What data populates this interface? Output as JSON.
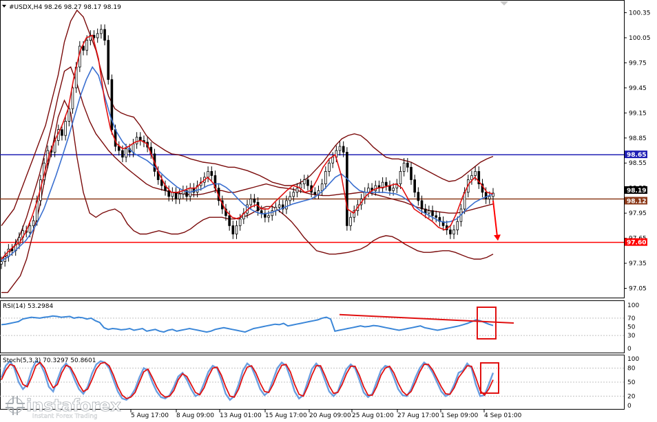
{
  "chart_data": {
    "type": "candlestick",
    "symbol_title": "#USDX,H4  98.26 98.27 98.17 98.19",
    "price_axis": {
      "ticks": [
        "100.35",
        "100.05",
        "99.75",
        "99.45",
        "99.15",
        "98.85",
        "98.55",
        "98.25",
        "97.95",
        "97.65",
        "97.35",
        "97.05"
      ],
      "range": [
        96.98,
        100.42
      ]
    },
    "levels": [
      {
        "label": "98.65",
        "value": 98.65,
        "color": "#1f1fb4"
      },
      {
        "label": "98.12",
        "value": 98.12,
        "color": "#8b3a1a"
      },
      {
        "label": "97.60",
        "value": 97.6,
        "color": "#ff0000"
      }
    ],
    "current_price": {
      "label": "98.19",
      "value": 98.19
    },
    "x_ticks": [
      "5 Aug 17:00",
      "8 Aug 09:00",
      "13 Aug 01:00",
      "15 Aug 17:00",
      "20 Aug 09:00",
      "25 Aug 01:00",
      "27 Aug 17:00",
      "1 Sep 09:00",
      "4 Sep 01:00"
    ],
    "candles": {
      "close": [
        97.37,
        97.43,
        97.52,
        97.5,
        97.58,
        97.66,
        97.74,
        97.72,
        97.8,
        97.86,
        98.1,
        98.35,
        98.55,
        98.7,
        98.68,
        98.82,
        98.95,
        98.88,
        99.05,
        99.2,
        99.45,
        99.7,
        99.95,
        99.9,
        100.02,
        100.08,
        100.05,
        100.1,
        100.15,
        100.02,
        99.55,
        98.95,
        98.75,
        98.7,
        98.62,
        98.72,
        98.68,
        98.78,
        98.86,
        98.82,
        98.8,
        98.74,
        98.66,
        98.45,
        98.35,
        98.28,
        98.22,
        98.15,
        98.2,
        98.12,
        98.18,
        98.22,
        98.15,
        98.25,
        98.2,
        98.28,
        98.32,
        98.38,
        98.45,
        98.4,
        98.25,
        98.1,
        98.0,
        97.92,
        97.8,
        97.7,
        97.8,
        97.88,
        97.95,
        98.05,
        98.12,
        98.08,
        97.98,
        97.95,
        97.9,
        97.92,
        97.98,
        98.02,
        98.05,
        98.0,
        98.1,
        98.15,
        98.2,
        98.25,
        98.3,
        98.35,
        98.28,
        98.2,
        98.18,
        98.22,
        98.3,
        98.45,
        98.55,
        98.62,
        98.7,
        98.75,
        98.68,
        97.8,
        97.9,
        97.98,
        98.05,
        98.12,
        98.2,
        98.25,
        98.22,
        98.28,
        98.25,
        98.32,
        98.28,
        98.22,
        98.25,
        98.3,
        98.45,
        98.55,
        98.5,
        98.35,
        98.2,
        98.1,
        98.0,
        97.95,
        97.98,
        97.92,
        97.9,
        97.85,
        97.8,
        97.75,
        97.7,
        97.75,
        97.85,
        98.0,
        98.2,
        98.35,
        98.4,
        98.45,
        98.3,
        98.2,
        98.12,
        98.15,
        98.19
      ],
      "spread": 0.12
    },
    "bollinger": {
      "upper": [
        97.8,
        97.9,
        98.0,
        98.2,
        98.4,
        98.6,
        98.8,
        99.0,
        99.3,
        99.6,
        100.0,
        100.25,
        100.38,
        100.3,
        100.1,
        99.9,
        99.6,
        99.35,
        99.2,
        99.15,
        99.12,
        99.1,
        99.0,
        98.88,
        98.8,
        98.75,
        98.7,
        98.66,
        98.65,
        98.63,
        98.6,
        98.58,
        98.56,
        98.55,
        98.54,
        98.52,
        98.5,
        98.5,
        98.48,
        98.46,
        98.43,
        98.4,
        98.36,
        98.32,
        98.3,
        98.28,
        98.28,
        98.3,
        98.34,
        98.4,
        98.48,
        98.56,
        98.66,
        98.76,
        98.84,
        98.88,
        98.9,
        98.88,
        98.82,
        98.74,
        98.68,
        98.62,
        98.6,
        98.6,
        98.58,
        98.56,
        98.52,
        98.48,
        98.44,
        98.4,
        98.36,
        98.33,
        98.34,
        98.38,
        98.44,
        98.5,
        98.56,
        98.6,
        98.63
      ],
      "middle": [
        97.4,
        97.45,
        97.55,
        97.7,
        97.9,
        98.15,
        98.4,
        98.7,
        99.0,
        99.35,
        99.65,
        99.7,
        99.5,
        99.25,
        99.05,
        98.9,
        98.8,
        98.7,
        98.62,
        98.55,
        98.48,
        98.42,
        98.36,
        98.3,
        98.26,
        98.24,
        98.22,
        98.2,
        98.19,
        98.18,
        98.17,
        98.17,
        98.18,
        98.2,
        98.22,
        98.22,
        98.2,
        98.2,
        98.22,
        98.24,
        98.26,
        98.28,
        98.3,
        98.28,
        98.26,
        98.25,
        98.24,
        98.22,
        98.2,
        98.18,
        98.17,
        98.16,
        98.16,
        98.17,
        98.18,
        98.18,
        98.19,
        98.2,
        98.2,
        98.18,
        98.16,
        98.14,
        98.12,
        98.1,
        98.08,
        98.05,
        98.02,
        98.0,
        97.98,
        97.97,
        97.96,
        97.95,
        97.95,
        97.96,
        97.98,
        98.0,
        98.02,
        98.04,
        98.06
      ],
      "lower": [
        97.0,
        97.0,
        97.1,
        97.2,
        97.4,
        97.7,
        98.0,
        98.4,
        98.7,
        99.1,
        99.3,
        99.15,
        98.62,
        98.2,
        97.95,
        97.9,
        97.95,
        97.98,
        98.0,
        97.95,
        97.82,
        97.74,
        97.7,
        97.7,
        97.72,
        97.74,
        97.72,
        97.7,
        97.7,
        97.72,
        97.76,
        97.82,
        97.87,
        97.9,
        97.9,
        97.9,
        97.88,
        97.88,
        97.9,
        97.92,
        97.96,
        98.0,
        98.03,
        98.03,
        97.98,
        97.92,
        97.85,
        97.76,
        97.66,
        97.58,
        97.5,
        97.48,
        97.46,
        97.46,
        97.47,
        97.48,
        97.5,
        97.52,
        97.56,
        97.62,
        97.66,
        97.68,
        97.67,
        97.63,
        97.58,
        97.54,
        97.5,
        97.48,
        97.48,
        97.49,
        97.5,
        97.5,
        97.48,
        97.45,
        97.42,
        97.4,
        97.4,
        97.42,
        97.46
      ]
    },
    "moving_averages": {
      "fast_red": [
        97.4,
        97.48,
        97.55,
        97.6,
        97.72,
        97.9,
        98.12,
        98.4,
        98.68,
        98.85,
        99.0,
        99.2,
        99.6,
        99.9,
        100.05,
        100.08,
        99.8,
        99.3,
        98.95,
        98.78,
        98.72,
        98.75,
        98.8,
        98.82,
        98.78,
        98.6,
        98.42,
        98.28,
        98.2,
        98.2,
        98.22,
        98.25,
        98.25,
        98.32,
        98.38,
        98.3,
        98.12,
        97.98,
        97.9,
        97.88,
        97.95,
        98.02,
        98.05,
        98.0,
        98.0,
        98.08,
        98.15,
        98.22,
        98.28,
        98.26,
        98.2,
        98.22,
        98.35,
        98.5,
        98.6,
        98.65,
        98.4,
        98.0,
        97.95,
        98.05,
        98.15,
        98.22,
        98.25,
        98.26,
        98.28,
        98.3,
        98.25,
        98.12,
        98.0,
        97.95,
        97.9,
        97.85,
        97.78,
        97.75,
        97.8,
        97.95,
        98.15,
        98.3,
        98.38,
        98.3,
        98.2,
        98.18
      ],
      "slow_blue": [
        97.38,
        97.42,
        97.48,
        97.55,
        97.62,
        97.72,
        97.85,
        98.0,
        98.2,
        98.4,
        98.62,
        98.85,
        99.1,
        99.35,
        99.55,
        99.7,
        99.6,
        99.35,
        99.1,
        98.92,
        98.8,
        98.72,
        98.66,
        98.62,
        98.58,
        98.52,
        98.45,
        98.38,
        98.32,
        98.26,
        98.22,
        98.2,
        98.22,
        98.24,
        98.28,
        98.3,
        98.3,
        98.26,
        98.2,
        98.12,
        98.05,
        98.0,
        97.96,
        97.94,
        97.95,
        97.97,
        98.0,
        98.03,
        98.06,
        98.08,
        98.1,
        98.12,
        98.16,
        98.22,
        98.3,
        98.38,
        98.42,
        98.36,
        98.28,
        98.22,
        98.2,
        98.2,
        98.2,
        98.2,
        98.19,
        98.18,
        98.15,
        98.1,
        98.04,
        97.98,
        97.94,
        97.9,
        97.86,
        97.84,
        97.85,
        97.88,
        97.95,
        98.02,
        98.08,
        98.12,
        98.15,
        98.18
      ]
    },
    "projection_arrow": {
      "from": 98.1,
      "to": 97.62,
      "color": "#ff0000"
    },
    "rsi": {
      "title": "RSI(14) 53.2984",
      "ticks": [
        "100",
        "70",
        "50",
        "30",
        "0"
      ],
      "levels": [
        70,
        30
      ],
      "values": [
        55,
        56,
        58,
        60,
        62,
        68,
        70,
        72,
        71,
        70,
        72,
        73,
        75,
        74,
        72,
        73,
        74,
        70,
        72,
        71,
        68,
        70,
        64,
        60,
        48,
        44,
        46,
        45,
        43,
        44,
        46,
        42,
        44,
        46,
        40,
        42,
        44,
        40,
        38,
        42,
        44,
        40,
        42,
        44,
        46,
        44,
        42,
        40,
        38,
        40,
        44,
        46,
        48,
        46,
        44,
        42,
        40,
        38,
        42,
        46,
        48,
        50,
        52,
        54,
        56,
        55,
        58,
        52,
        54,
        56,
        58,
        60,
        62,
        64,
        66,
        70,
        72,
        68,
        40,
        42,
        44,
        46,
        48,
        50,
        52,
        50,
        51,
        53,
        52,
        50,
        48,
        46,
        44,
        42,
        44,
        46,
        48,
        50,
        52,
        48,
        46,
        44,
        42,
        44,
        46,
        48,
        50,
        52,
        55,
        58,
        62,
        66,
        64,
        60,
        56,
        53
      ],
      "trend_from": 75,
      "trend_to": 62
    },
    "stochastic": {
      "title": "Stoch(5,3,3) 70.3297 50.8601",
      "ticks": [
        "100",
        "80",
        "50",
        "20",
        "0"
      ],
      "levels": [
        80,
        50,
        20
      ],
      "k": [
        60,
        85,
        95,
        80,
        50,
        35,
        45,
        75,
        95,
        90,
        70,
        40,
        30,
        55,
        80,
        90,
        78,
        55,
        35,
        25,
        40,
        68,
        88,
        95,
        92,
        80,
        55,
        30,
        15,
        12,
        20,
        35,
        60,
        80,
        75,
        50,
        30,
        18,
        15,
        22,
        40,
        62,
        70,
        55,
        35,
        20,
        25,
        48,
        72,
        85,
        80,
        55,
        25,
        12,
        20,
        45,
        75,
        90,
        82,
        60,
        35,
        22,
        30,
        55,
        80,
        92,
        85,
        60,
        30,
        15,
        22,
        50,
        78,
        90,
        80,
        55,
        30,
        20,
        30,
        55,
        78,
        88,
        80,
        55,
        28,
        18,
        25,
        50,
        75,
        85,
        82,
        60,
        35,
        22,
        20,
        35,
        60,
        80,
        92,
        85,
        70,
        50,
        30,
        20,
        25,
        45,
        70,
        75,
        90,
        80,
        45,
        20,
        22,
        45,
        70
      ],
      "d": [
        55,
        75,
        88,
        85,
        65,
        45,
        40,
        60,
        85,
        92,
        80,
        55,
        38,
        45,
        70,
        86,
        82,
        65,
        45,
        30,
        35,
        55,
        78,
        90,
        92,
        85,
        65,
        40,
        22,
        15,
        18,
        28,
        50,
        72,
        78,
        60,
        40,
        25,
        18,
        20,
        32,
        55,
        68,
        62,
        45,
        28,
        23,
        38,
        62,
        80,
        82,
        65,
        40,
        20,
        18,
        35,
        62,
        82,
        85,
        70,
        48,
        30,
        28,
        45,
        68,
        86,
        88,
        72,
        45,
        24,
        20,
        40,
        65,
        85,
        85,
        65,
        42,
        26,
        28,
        45,
        68,
        84,
        84,
        65,
        40,
        22,
        22,
        40,
        65,
        80,
        84,
        70,
        48,
        30,
        22,
        30,
        50,
        72,
        88,
        88,
        76,
        58,
        40,
        25,
        24,
        38,
        60,
        72,
        85,
        84,
        60,
        32,
        22,
        35,
        55
      ]
    },
    "watermark": {
      "brand": "instaforex",
      "tagline": "Instant Forex Trading"
    }
  }
}
